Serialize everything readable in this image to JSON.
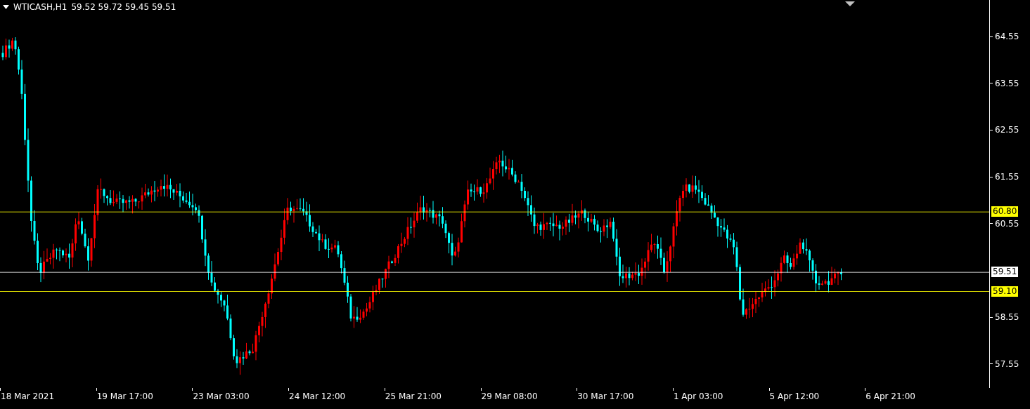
{
  "chart": {
    "symbol": "WTICASH,H1",
    "prices": "59.52 59.72 59.45 59.51"
  },
  "price_axis": {
    "ticks": [
      "64.55",
      "63.55",
      "62.55",
      "61.55",
      "60.55",
      "58.55",
      "57.55"
    ]
  },
  "price_lines": [
    {
      "label": "60.80",
      "color": "#ffff00"
    },
    {
      "label": "59.51",
      "color": "#ffffff"
    },
    {
      "label": "59.10",
      "color": "#ffff00"
    }
  ],
  "time_axis": [
    "18 Mar 2021",
    "19 Mar 17:00",
    "23 Mar 03:00",
    "24 Mar 12:00",
    "25 Mar 21:00",
    "29 Mar 08:00",
    "30 Mar 17:00",
    "1 Apr 03:00",
    "5 Apr 12:00",
    "6 Apr 21:00"
  ]
}
